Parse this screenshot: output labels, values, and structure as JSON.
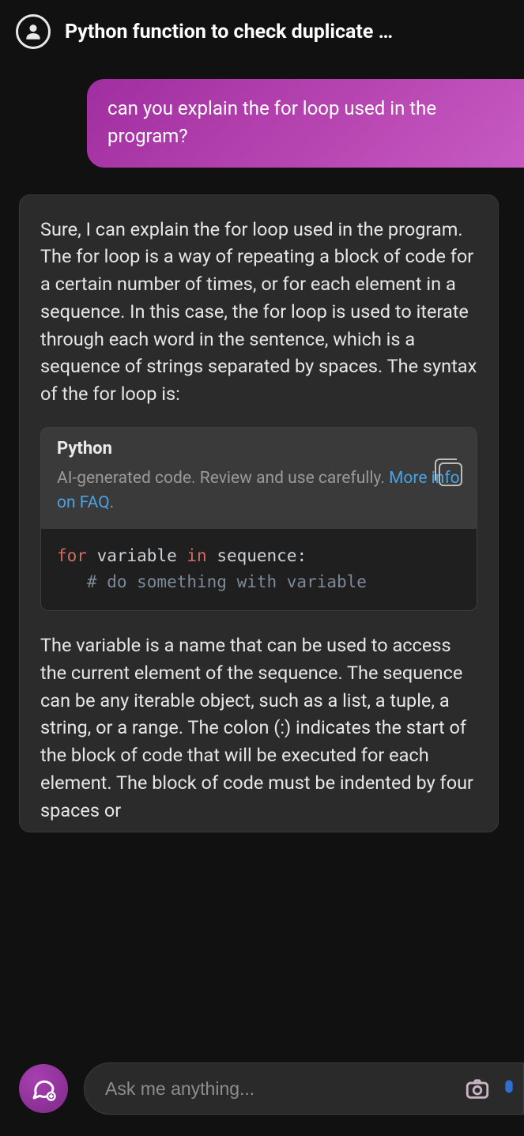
{
  "header": {
    "title": "Python function to check duplicate …"
  },
  "user_message": {
    "text": "can you explain the for loop used in the program?"
  },
  "assistant_message": {
    "intro": "Sure, I can explain the for loop used in the program. The for loop is a way of repeating a block of code for a certain number of times, or for each element in a sequence. In this case, the for loop is used to iterate through each word in the sentence, which is a sequence of strings separated by spaces. The syntax of the for loop is:",
    "code_block": {
      "language": "Python",
      "disclaimer_prefix": "AI-generated code. Review and use carefully. ",
      "disclaimer_link": "More info on FAQ",
      "kw_for": "for",
      "var1": " variable ",
      "kw_in": "in",
      "rest1": " sequence:",
      "line2": "   # do something with variable"
    },
    "after": "The variable is a name that can be used to access the current element of the sequence. The sequence can be any iterable object, such as a list, a tuple, a string, or a range. The colon (:) indicates the start of the block of code that will be executed for each element. The block of code must be indented by four spaces or"
  },
  "composer": {
    "placeholder": "Ask me anything..."
  }
}
